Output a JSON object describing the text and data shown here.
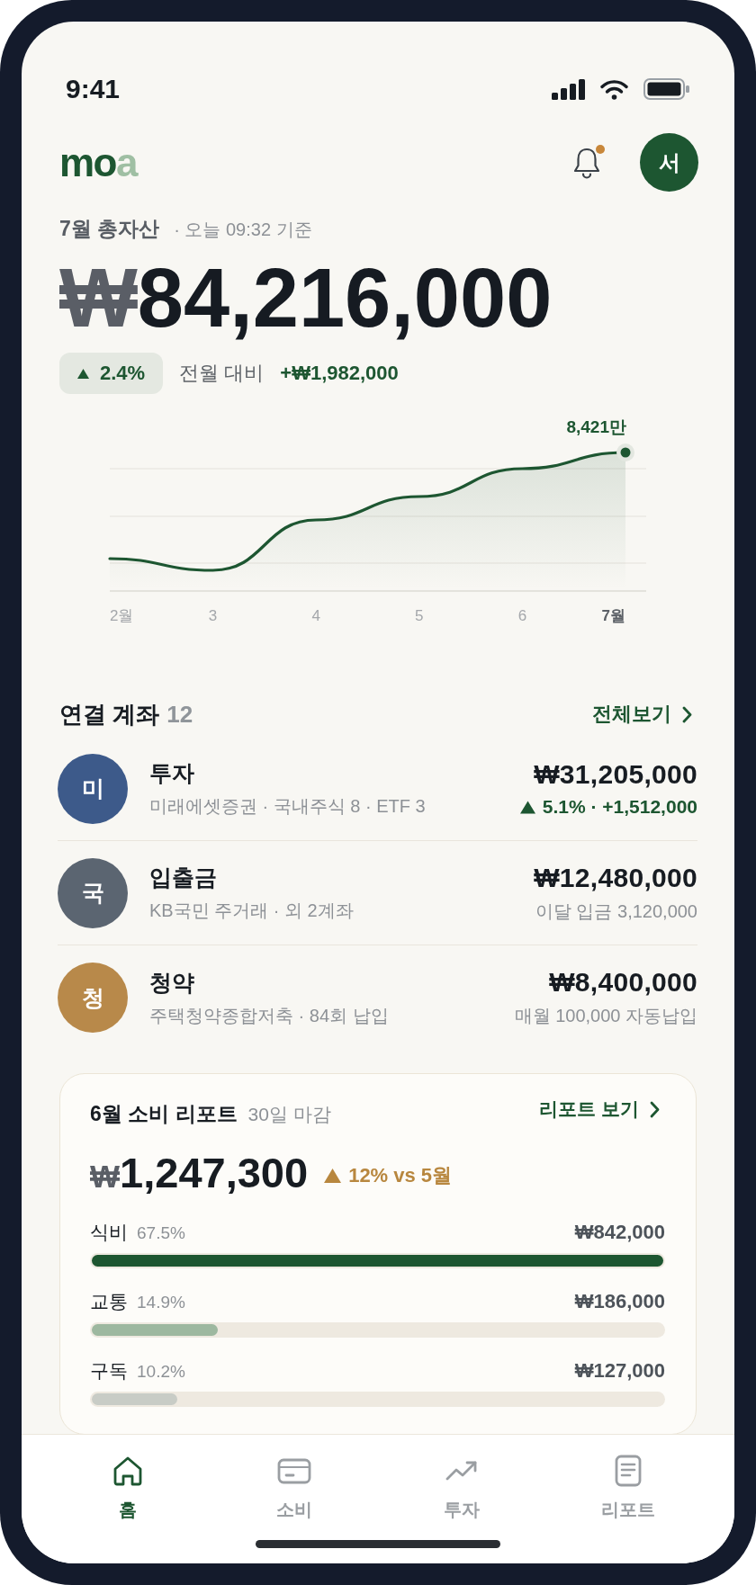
{
  "status_bar": {
    "time": "9:41"
  },
  "header": {
    "logo": {
      "main": "mo",
      "accent": "a"
    },
    "unread_notifications": true,
    "avatar_initial": "서"
  },
  "summary": {
    "title": "7월 총자산",
    "timestamp": "· 오늘 09:32 기준",
    "total": {
      "currency": "₩",
      "value": "84,216,000"
    },
    "change": {
      "rising": true,
      "percent": "2.4%",
      "label": "전월 대비",
      "amount": "+₩1,982,000"
    }
  },
  "chart": {
    "x_labels": [
      {
        "label": "2월",
        "current": false
      },
      {
        "label": "3",
        "current": false
      },
      {
        "label": "4",
        "current": false
      },
      {
        "label": "5",
        "current": false
      },
      {
        "label": "6",
        "current": false
      },
      {
        "label": "7월",
        "current": true
      }
    ],
    "end_label": "8,421만"
  },
  "accounts": {
    "title": "연결 계좌",
    "count": "12",
    "view_all": "전체보기",
    "items": [
      {
        "initial": "미",
        "color": "#3d5a8a",
        "name": "투자",
        "detail": "미래에셋증권 · 국내주식 8 · ETF 3",
        "balance": "₩31,205,000",
        "note": {
          "kind": "trend",
          "rising": true,
          "text": "5.1% · +1,512,000"
        }
      },
      {
        "initial": "국",
        "color": "#5b6571",
        "name": "입출금",
        "detail": "KB국민 주거래 · 외 2계좌",
        "balance": "₩12,480,000",
        "note": {
          "kind": "text",
          "text": "이달 입금 3,120,000"
        }
      },
      {
        "initial": "청",
        "color": "#b8894a",
        "name": "청약",
        "detail": "주택청약종합저축 · 84회 납입",
        "balance": "₩8,400,000",
        "note": {
          "kind": "text",
          "text": "매월 100,000 자동납입"
        }
      }
    ]
  },
  "report": {
    "title": "6월 소비 리포트",
    "subtitle": "30일 마감",
    "link": "리포트 보기",
    "total": {
      "currency": "₩",
      "value": "1,247,300"
    },
    "change": {
      "rising": true,
      "text": "12% vs 5월"
    },
    "categories": [
      {
        "name": "식비",
        "share": "67.5%",
        "amount": "₩842,000",
        "level": 1,
        "color": "#1d5631"
      },
      {
        "name": "교통",
        "share": "14.9%",
        "amount": "₩186,000",
        "level": 0.22,
        "color": "#9db8a0"
      },
      {
        "name": "구독",
        "share": "10.2%",
        "amount": "₩127,000",
        "level": 0.15,
        "color": "#c8ccc6"
      }
    ]
  },
  "nav": [
    {
      "label": "홈",
      "selected": true
    },
    {
      "label": "소비",
      "selected": false
    },
    {
      "label": "투자",
      "selected": false
    },
    {
      "label": "리포트",
      "selected": false
    }
  ]
}
